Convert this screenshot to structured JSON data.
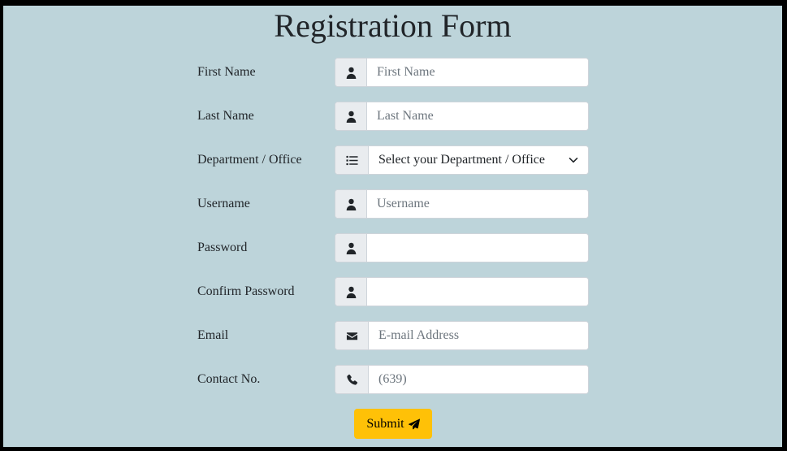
{
  "form": {
    "title": "Registration Form",
    "fields": [
      {
        "label": "First Name",
        "icon": "user-icon",
        "placeholder": "First Name",
        "value": ""
      },
      {
        "label": "Last Name",
        "icon": "user-icon",
        "placeholder": "Last Name",
        "value": ""
      },
      {
        "label": "Department / Office",
        "icon": "list-icon",
        "selected": "Select your Department / Office"
      },
      {
        "label": "Username",
        "icon": "user-icon",
        "placeholder": "Username",
        "value": ""
      },
      {
        "label": "Password",
        "icon": "user-icon",
        "placeholder": "",
        "value": ""
      },
      {
        "label": "Confirm Password",
        "icon": "user-icon",
        "placeholder": "",
        "value": ""
      },
      {
        "label": "Email",
        "icon": "envelope-icon",
        "placeholder": "E-mail Address",
        "value": ""
      },
      {
        "label": "Contact No.",
        "icon": "phone-icon",
        "placeholder": "(639)",
        "value": ""
      }
    ],
    "submit_label": "Submit"
  },
  "colors": {
    "background": "#bdd4da",
    "addon": "#e9ecef",
    "submit": "#ffc107",
    "text": "#212529"
  }
}
